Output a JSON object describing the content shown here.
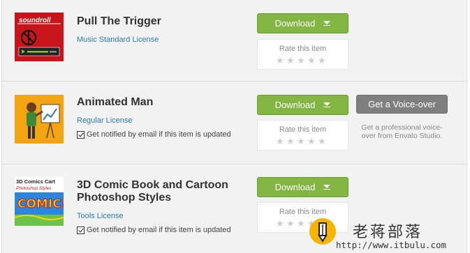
{
  "items": [
    {
      "title": "Pull The Trigger",
      "license": "Music Standard License",
      "thumb_text": "soundroll",
      "download_label": "Download",
      "rate_label": "Rate this item"
    },
    {
      "title": "Animated Man",
      "license": "Regular License",
      "notify_label": "Get notified by email if this item is updated",
      "download_label": "Download",
      "rate_label": "Rate this item",
      "voiceover_label": "Get a Voice-over",
      "voiceover_text": "Get a professional voice-over from Envato Studio."
    },
    {
      "title_line1": "3D Comic Book and Cartoon",
      "title_line2": "Photoshop Styles",
      "license": "Tools License",
      "notify_label": "Get notified by email if this item is updated",
      "download_label": "Download",
      "rate_label": "Rate this item",
      "thumb_text_top": "3D Comics Cart",
      "thumb_text_mid": "Photoshop Styles",
      "thumb_text_big": "COMIC!"
    }
  ],
  "watermark": {
    "name": "老蒋部落",
    "url": "http://www.itbulu.com"
  },
  "colors": {
    "download_green": "#82b541",
    "voiceover_gray": "#7f7f7f",
    "license_blue": "#2a7ab0"
  }
}
